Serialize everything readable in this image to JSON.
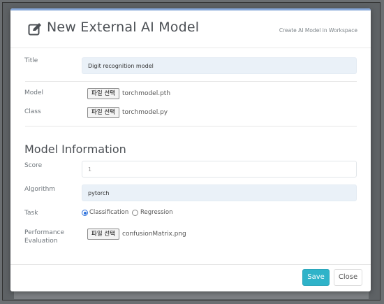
{
  "modal": {
    "title": "New External AI Model",
    "subtitle": "Create AI Model in Workspace"
  },
  "form": {
    "title": {
      "label": "Title",
      "value": "Digit recognition model"
    },
    "model": {
      "label": "Model",
      "button": "파일 선택",
      "file": "torchmodel.pth"
    },
    "class": {
      "label": "Class",
      "button": "파일 선택",
      "file": "torchmodel.py"
    },
    "section_title": "Model Information",
    "score": {
      "label": "Score",
      "placeholder": "1"
    },
    "algorithm": {
      "label": "Algorithm",
      "value": "pytorch"
    },
    "task": {
      "label": "Task",
      "options": [
        {
          "label": "Classification",
          "checked": true
        },
        {
          "label": "Regression",
          "checked": false
        }
      ]
    },
    "performance": {
      "label_line1": "Performance",
      "label_line2": "Evaluation",
      "button": "파일 선택",
      "file": "confusionMatrix.png"
    }
  },
  "footer": {
    "save_label": "Save",
    "close_label": "Close"
  },
  "colors": {
    "accent": "#2fb3c9",
    "field_fill": "#eaf1f8",
    "radio": "#2a6fdb"
  },
  "icons": {
    "title_icon": "edit-icon"
  }
}
